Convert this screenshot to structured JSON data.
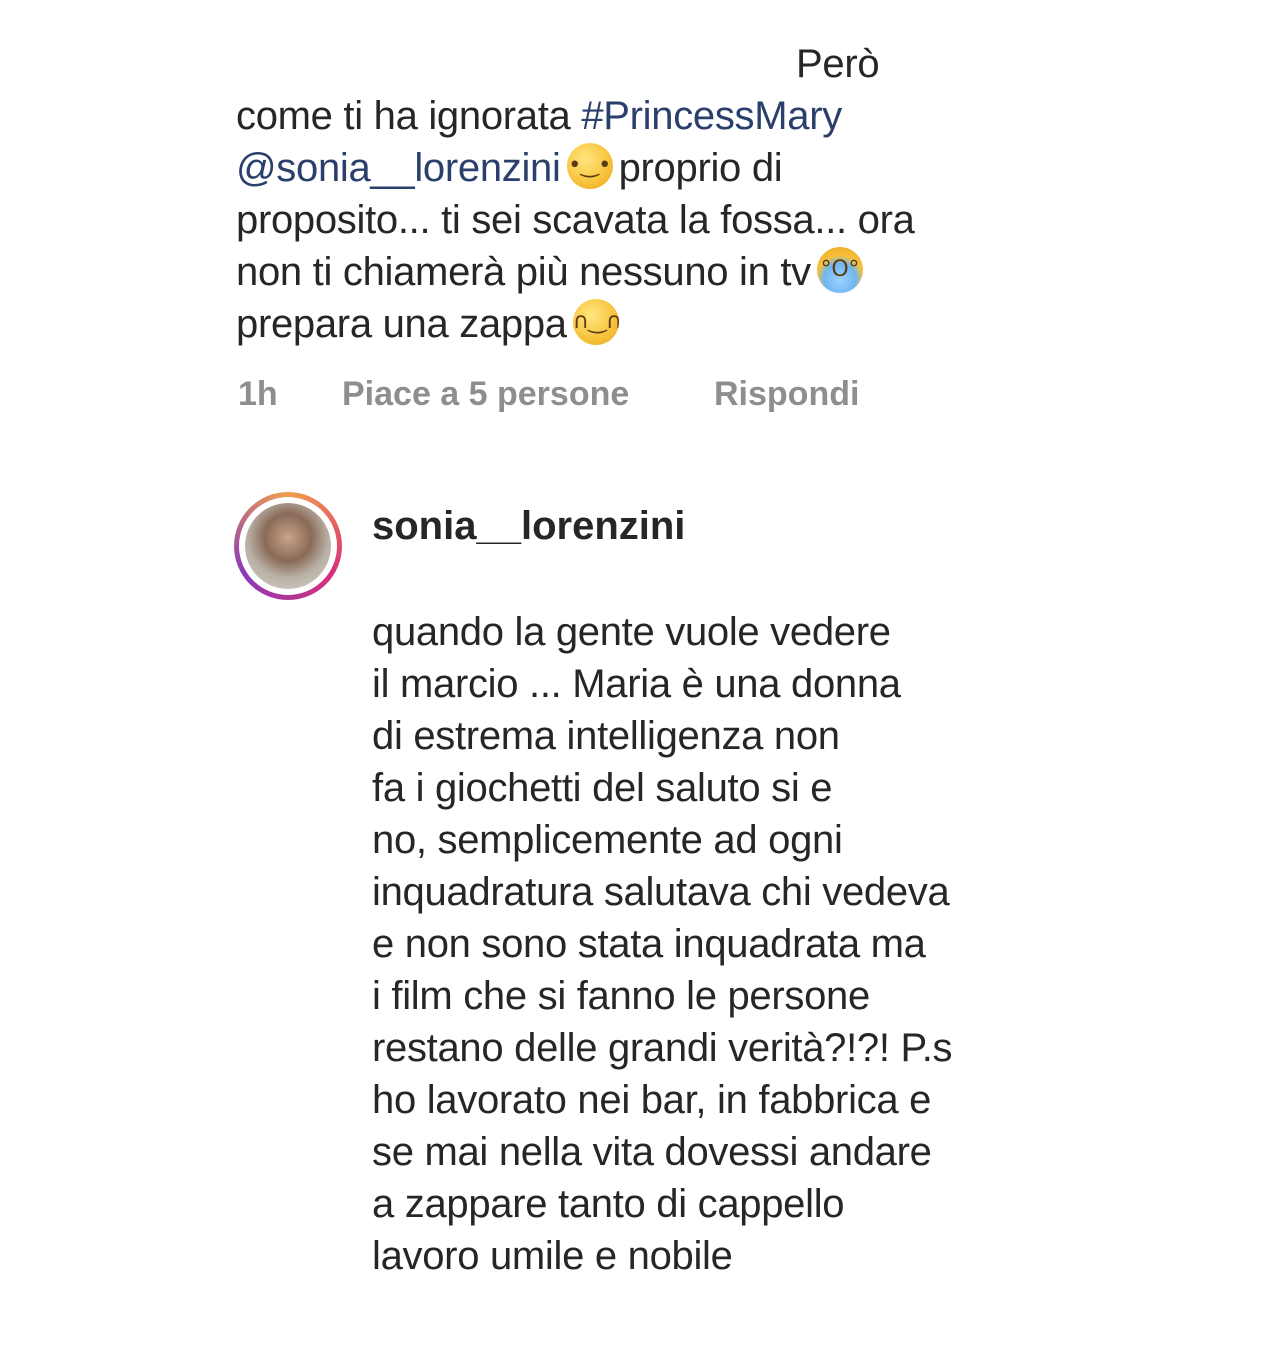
{
  "comment": {
    "lines": [
      "Però",
      "come ti ha ignorata",
      "#PrincessMary",
      "@sonia__lorenzini",
      "proprio di",
      "proposito... ti sei scavata la fossa... ora",
      "non ti chiamerà più nessuno in tv",
      "prepara una zappa"
    ],
    "emojis": [
      "drooling-face-emoji",
      "screaming-face-emoji",
      "tears-of-joy-emoji"
    ],
    "time": "1h",
    "likes": "Piace a 5 persone",
    "reply_label": "Rispondi"
  },
  "reply": {
    "username": "sonia__lorenzini",
    "lines": [
      "quando la gente vuole vedere",
      "il marcio ... Maria è una donna",
      "di estrema intelligenza non",
      "fa i giochetti del saluto si e",
      "no, semplicemente ad ogni",
      "inquadratura salutava chi vedeva",
      "e non sono stata inquadrata ma",
      "i film che si fanno le persone",
      "restano delle grandi verità?!?! P.s",
      "ho lavorato nei bar, in fabbrica e",
      "se mai nella vita dovessi andare",
      "a zappare tanto di cappello",
      "lavoro umile e nobile"
    ]
  }
}
